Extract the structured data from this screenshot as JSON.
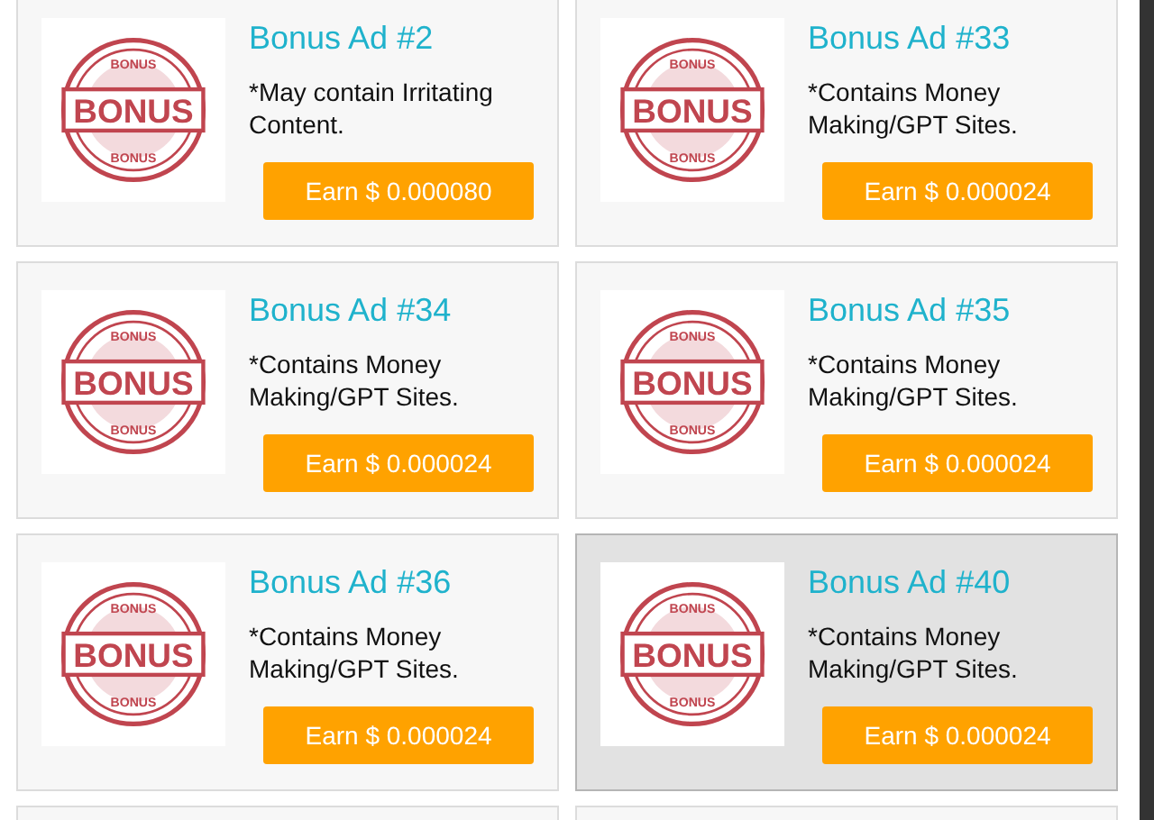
{
  "ads": [
    {
      "title": "Bonus Ad #2",
      "note": "*May contain Irritating Content.",
      "button": "Earn $ 0.000080",
      "highlighted": false,
      "stamp": {
        "label": "BONUS",
        "ring_top": "BONUS",
        "ring_bottom": "BONUS"
      }
    },
    {
      "title": "Bonus Ad #33",
      "note": "*Contains Money Making/GPT Sites.",
      "button": "Earn $ 0.000024",
      "highlighted": false,
      "stamp": {
        "label": "BONUS",
        "ring_top": "BONUS",
        "ring_bottom": "BONUS"
      }
    },
    {
      "title": "Bonus Ad #34",
      "note": "*Contains Money Making/GPT Sites.",
      "button": "Earn $ 0.000024",
      "highlighted": false,
      "stamp": {
        "label": "BONUS",
        "ring_top": "BONUS",
        "ring_bottom": "BONUS"
      }
    },
    {
      "title": "Bonus Ad #35",
      "note": "*Contains Money Making/GPT Sites.",
      "button": "Earn $ 0.000024",
      "highlighted": false,
      "stamp": {
        "label": "BONUS",
        "ring_top": "BONUS",
        "ring_bottom": "BONUS"
      }
    },
    {
      "title": "Bonus Ad #36",
      "note": "*Contains Money Making/GPT Sites.",
      "button": "Earn $ 0.000024",
      "highlighted": false,
      "stamp": {
        "label": "BONUS",
        "ring_top": "BONUS",
        "ring_bottom": "BONUS"
      }
    },
    {
      "title": "Bonus Ad #40",
      "note": "*Contains Money Making/GPT Sites.",
      "button": "Earn $ 0.000024",
      "highlighted": true,
      "stamp": {
        "label": "BONUS",
        "ring_top": "BONUS",
        "ring_bottom": "BONUS"
      }
    }
  ]
}
